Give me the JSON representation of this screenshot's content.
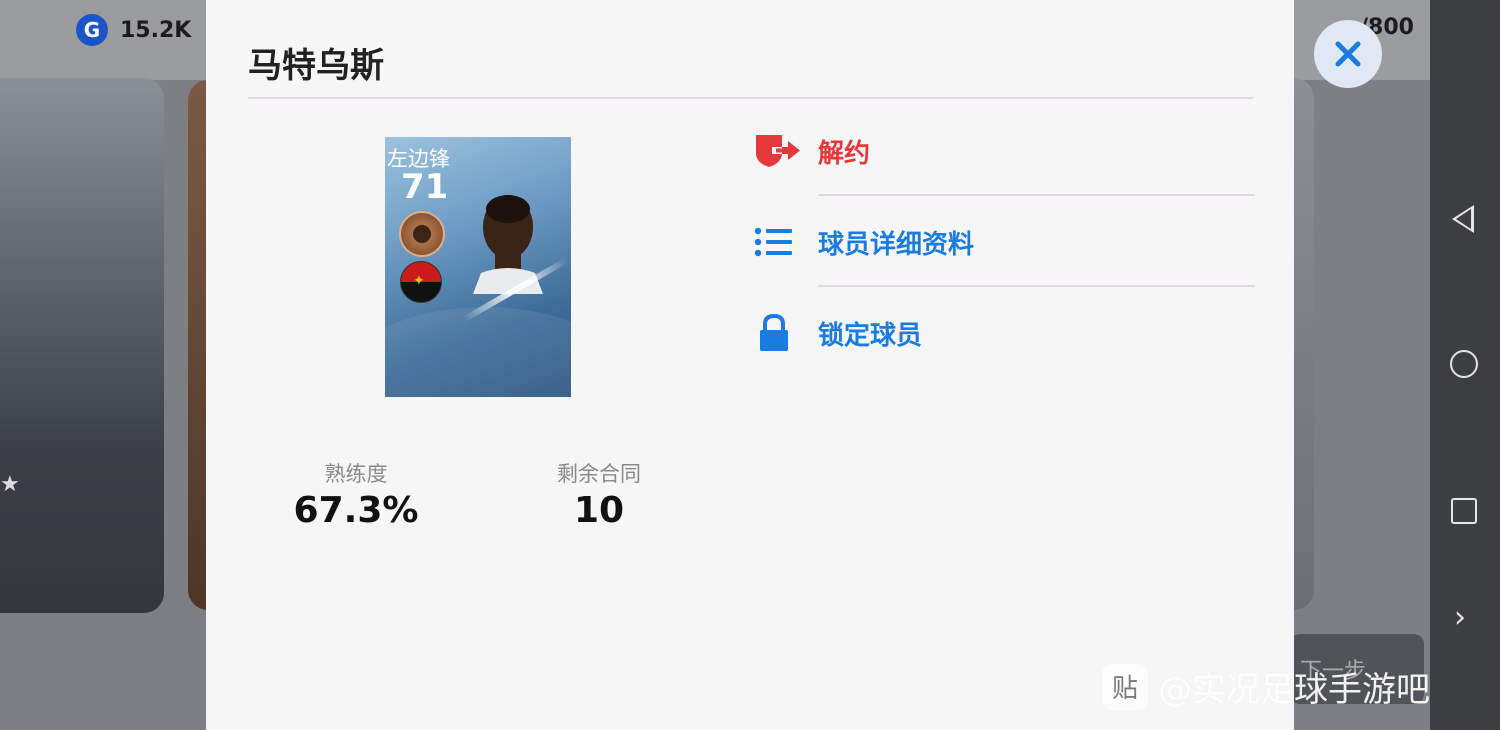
{
  "background": {
    "currency_icon": "G",
    "currency_value": "15.2K",
    "player_count": "/800",
    "next_label": "下一步"
  },
  "modal": {
    "title": "马特乌斯",
    "close_icon": "close-icon"
  },
  "player_card": {
    "position": "左边锋",
    "rating": "71",
    "nationality_flag": "angola-flag-icon"
  },
  "stats": {
    "proficiency_label": "熟练度",
    "proficiency_value": "67.3%",
    "contract_label": "剩余合同",
    "contract_value": "10"
  },
  "actions": [
    {
      "label": "解约",
      "icon": "release-contract-icon",
      "color": "#e5393b"
    },
    {
      "label": "球员详细资料",
      "icon": "list-icon",
      "color": "#1a7be0"
    },
    {
      "label": "锁定球员",
      "icon": "lock-icon",
      "color": "#1a7be0"
    }
  ],
  "watermark": {
    "icon_text": "贴",
    "text": "@实况足球手游吧"
  },
  "colors": {
    "accent_blue": "#1a7be0",
    "danger_red": "#e5393b"
  }
}
